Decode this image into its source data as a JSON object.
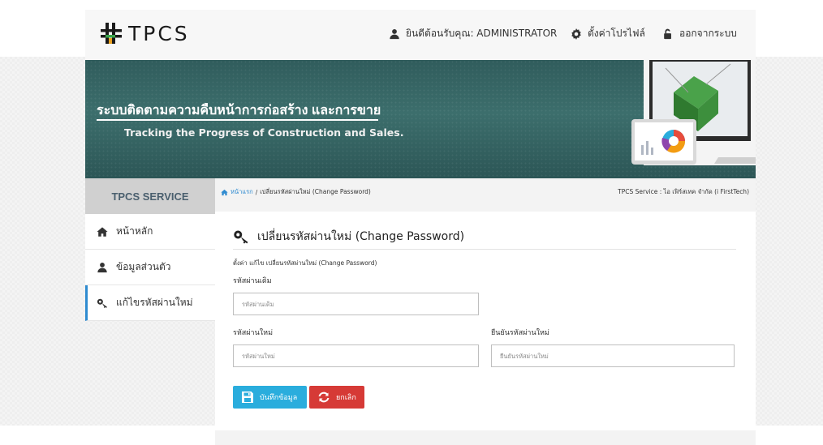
{
  "header": {
    "logo_text": "TPCS",
    "welcome_label": "ยินดีต้อนรับคุณ: ADMINISTRATOR",
    "profile_label": "ตั้งค่าโปรไฟล์",
    "logout_label": "ออกจากระบบ"
  },
  "banner": {
    "title_th": "ระบบติดตามความคืบหน้าการก่อสร้าง และการขาย",
    "title_en": "Tracking the Progress of Construction and Sales."
  },
  "sidebar": {
    "title": "TPCS SERVICE",
    "items": [
      {
        "label": "หน้าหลัก",
        "icon": "home-icon"
      },
      {
        "label": "ข้อมูลส่วนตัว",
        "icon": "user-icon"
      },
      {
        "label": "แก้ไขรหัสผ่านใหม่",
        "icon": "key-icon",
        "active": true
      }
    ]
  },
  "breadcrumb": {
    "home": "หน้าแรก",
    "separator": "/",
    "current": "เปลี่ยนรหัสผ่านใหม่ (Change Password)",
    "right": "TPCS Service : ไอ เฟิร์สเทค จำกัด (i FirstTech)"
  },
  "form": {
    "title": "เปลี่ยนรหัสผ่านใหม่ (Change Password)",
    "subtitle": "ตั้งค่า แก้ไข เปลี่ยนรหัสผ่านใหม่ (Change Password)",
    "old_password_label": "รหัสผ่านเดิม",
    "old_password_placeholder": "รหัสผ่านเดิม",
    "new_password_label": "รหัสผ่านใหม่",
    "new_password_placeholder": "รหัสผ่านใหม่",
    "confirm_password_label": "ยืนยันรหัสผ่านใหม่",
    "confirm_password_placeholder": "ยืนยันรหัสผ่านใหม่",
    "save_label": "บันทึกข้อมูล",
    "cancel_label": "ยกเลิก"
  },
  "colors": {
    "accent_blue": "#2aaddd",
    "danger_red": "#d63a36",
    "banner_teal": "#3c6e6c",
    "link_blue": "#2f8bd0"
  }
}
